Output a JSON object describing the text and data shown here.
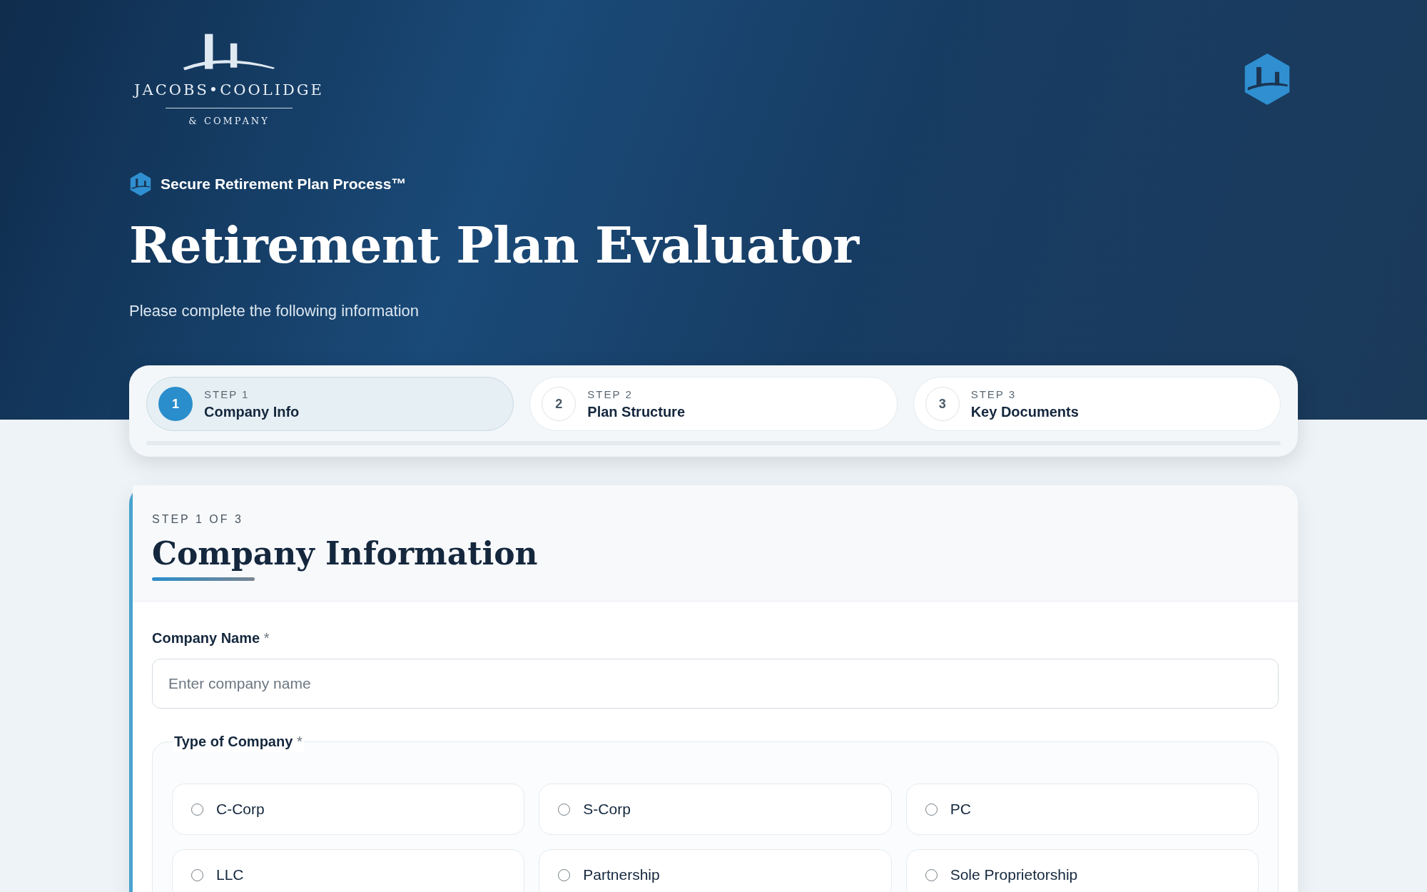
{
  "brand": {
    "name": "JACOBS•COOLIDGE",
    "sub": "& COMPANY"
  },
  "tagline": "Secure Retirement Plan Process™",
  "title": "Retirement Plan Evaluator",
  "subtitle": "Please complete the following information",
  "steps": [
    {
      "number": "1",
      "label": "STEP 1",
      "name": "Company Info",
      "selected": true
    },
    {
      "number": "2",
      "label": "STEP 2",
      "name": "Plan Structure",
      "selected": false
    },
    {
      "number": "3",
      "label": "STEP 3",
      "name": "Key Documents",
      "selected": false
    }
  ],
  "form": {
    "eyebrow": "STEP 1 OF 3",
    "heading": "Company Information",
    "company_name": {
      "label": "Company Name",
      "required": "*",
      "placeholder": "Enter company name"
    },
    "company_type": {
      "label": "Type of Company",
      "required": "*",
      "options": [
        {
          "label": "C-Corp",
          "checked": false
        },
        {
          "label": "S-Corp",
          "checked": false
        },
        {
          "label": "PC",
          "checked": false
        },
        {
          "label": "LLC",
          "checked": false
        },
        {
          "label": "Partnership",
          "checked": false
        },
        {
          "label": "Sole Proprietorship",
          "checked": false
        }
      ]
    }
  }
}
